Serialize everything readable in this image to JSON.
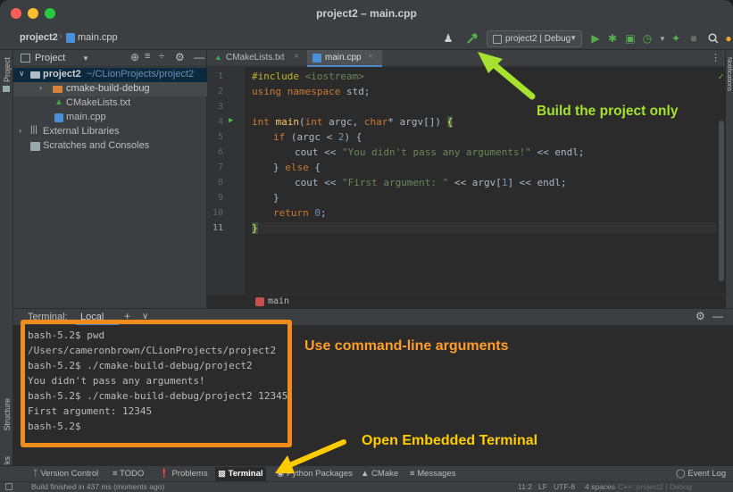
{
  "window": {
    "title": "project2 – main.cpp",
    "traffic_colors": [
      "#ff5f57",
      "#febc2e",
      "#28c840"
    ]
  },
  "navbar": {
    "project": "project2",
    "separator": "›",
    "file": "main.cpp",
    "run_config": "project2 | Debug"
  },
  "left_strip": {
    "project_label": "Project",
    "structure_label": "Structure",
    "bookmarks_label": "Bookmarks"
  },
  "right_strip": {
    "label": "Notifications"
  },
  "project_panel": {
    "title": "Project",
    "tree": [
      {
        "label": "project2",
        "path": "~/CLionProjects/project2"
      },
      {
        "label": "cmake-build-debug"
      },
      {
        "label": "CMakeLists.txt"
      },
      {
        "label": "main.cpp"
      },
      {
        "label": "External Libraries"
      },
      {
        "label": "Scratches and Consoles"
      }
    ]
  },
  "editor": {
    "tabs": [
      "CMakeLists.txt",
      "main.cpp"
    ],
    "line_numbers": [
      "1",
      "2",
      "3",
      "4",
      "5",
      "6",
      "7",
      "8",
      "9",
      "10",
      "11"
    ],
    "code": {
      "l1_pp": "#include ",
      "l1_header": "<iostream>",
      "l2_kw1": "using namespace ",
      "l2_rest": "std;",
      "l4_kw": "int ",
      "l4_fn": "main",
      "l4_a": "(",
      "l4_kw2": "int ",
      "l4_b": "argc, ",
      "l4_kw3": "char",
      "l4_c": "* argv[]) ",
      "l4_brace": "{",
      "l5_kw": "if ",
      "l5_a": "(argc < ",
      "l5_num": "2",
      "l5_b": ") {",
      "l6_a": "cout << ",
      "l6_str": "\"You didn't pass any arguments!\"",
      "l6_b": " << endl;",
      "l7_a": "} ",
      "l7_kw": "else",
      "l7_b": " {",
      "l8_a": "cout << ",
      "l8_str": "\"First argument: \"",
      "l8_b": " << argv[",
      "l8_num": "1",
      "l8_c": "] << endl;",
      "l9": "}",
      "l10_kw": "return ",
      "l10_num": "0",
      "l10_b": ";",
      "l11": "}"
    },
    "breadcrumb": "main"
  },
  "terminal": {
    "header_title": "Terminal:",
    "tab": "Local",
    "add": "+",
    "caret": "∨",
    "lines": [
      "bash-5.2$ pwd",
      "/Users/cameronbrown/CLionProjects/project2",
      "bash-5.2$ ./cmake-build-debug/project2",
      "You didn't pass any arguments!",
      "bash-5.2$ ./cmake-build-debug/project2 12345",
      "First argument: 12345",
      "bash-5.2$"
    ]
  },
  "bottom_tools": {
    "version_control": "Version Control",
    "todo": "TODO",
    "problems": "Problems",
    "terminal": "Terminal",
    "python_packages": "Python Packages",
    "cmake": "CMake",
    "messages": "Messages",
    "event_log": "Event Log"
  },
  "status": {
    "message": "Build finished in 437 ms (moments ago)",
    "position": "11:2",
    "line_sep": "LF",
    "encoding": "UTF-8",
    "indent": "4 spaces",
    "context": "C++: project2 | Debug"
  },
  "annotations": {
    "build": "Build the project only",
    "args": "Use command-line arguments",
    "embedded": "Open Embedded Terminal"
  }
}
